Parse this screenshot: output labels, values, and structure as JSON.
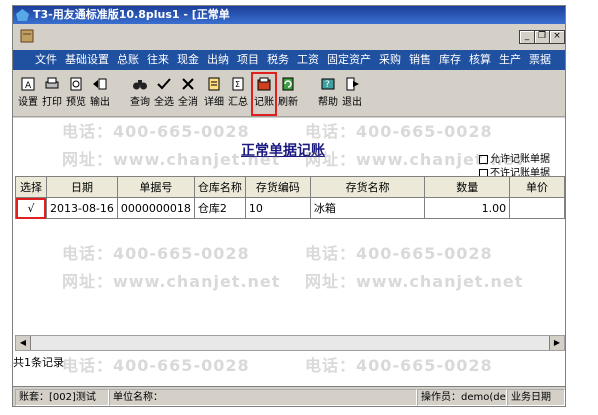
{
  "window": {
    "title": "T3-用友通标准版10.8plus1 - [正常单"
  },
  "win_buttons": {
    "minimize": "_",
    "restore": "❐",
    "close": "×"
  },
  "menu": [
    "文件",
    "基础设置",
    "总账",
    "往来",
    "现金",
    "出纳",
    "项目",
    "税务",
    "工资",
    "固定资产",
    "采购",
    "销售",
    "库存",
    "核算",
    "生产",
    "票据"
  ],
  "toolbar": [
    {
      "label": "设置",
      "icon": "settings-icon"
    },
    {
      "label": "打印",
      "icon": "print-icon"
    },
    {
      "label": "预览",
      "icon": "preview-icon"
    },
    {
      "label": "输出",
      "icon": "export-icon"
    },
    {
      "label": "查询",
      "icon": "binoculars-icon"
    },
    {
      "label": "全选",
      "icon": "select-all-icon"
    },
    {
      "label": "全消",
      "icon": "deselect-all-icon"
    },
    {
      "label": "详细",
      "icon": "detail-icon"
    },
    {
      "label": "汇总",
      "icon": "summary-icon"
    },
    {
      "label": "记账",
      "icon": "post-icon"
    },
    {
      "label": "刷新",
      "icon": "refresh-icon"
    },
    {
      "label": "帮助",
      "icon": "help-icon"
    },
    {
      "label": "退出",
      "icon": "exit-icon"
    }
  ],
  "page_title": "正常单据记账",
  "options": {
    "allow": "允许记账单据",
    "disallow": "不许记账单据"
  },
  "table": {
    "headers": [
      "选择",
      "日期",
      "单据号",
      "仓库名称",
      "存货编码",
      "存货名称",
      "数量",
      "单价"
    ],
    "rows": [
      {
        "select": "√",
        "date": "2013-08-16",
        "doc_no": "0000000018",
        "warehouse": "仓库2",
        "item_code": "10",
        "item_name": "冰箱",
        "qty": "1.00",
        "price": ""
      }
    ]
  },
  "record_count": "共1条记录",
  "status": {
    "account": "账套：[002]测试",
    "unit": "单位名称：",
    "operator": "操作员：demo(de",
    "date": "业务日期"
  },
  "watermarks": {
    "phone": "电话：400-665-0028",
    "url": "网址：www.chanjet.net"
  },
  "colors": {
    "title_bar": "#1b3f9a",
    "menu_bar": "#2050a0",
    "highlight": "#e02020"
  }
}
